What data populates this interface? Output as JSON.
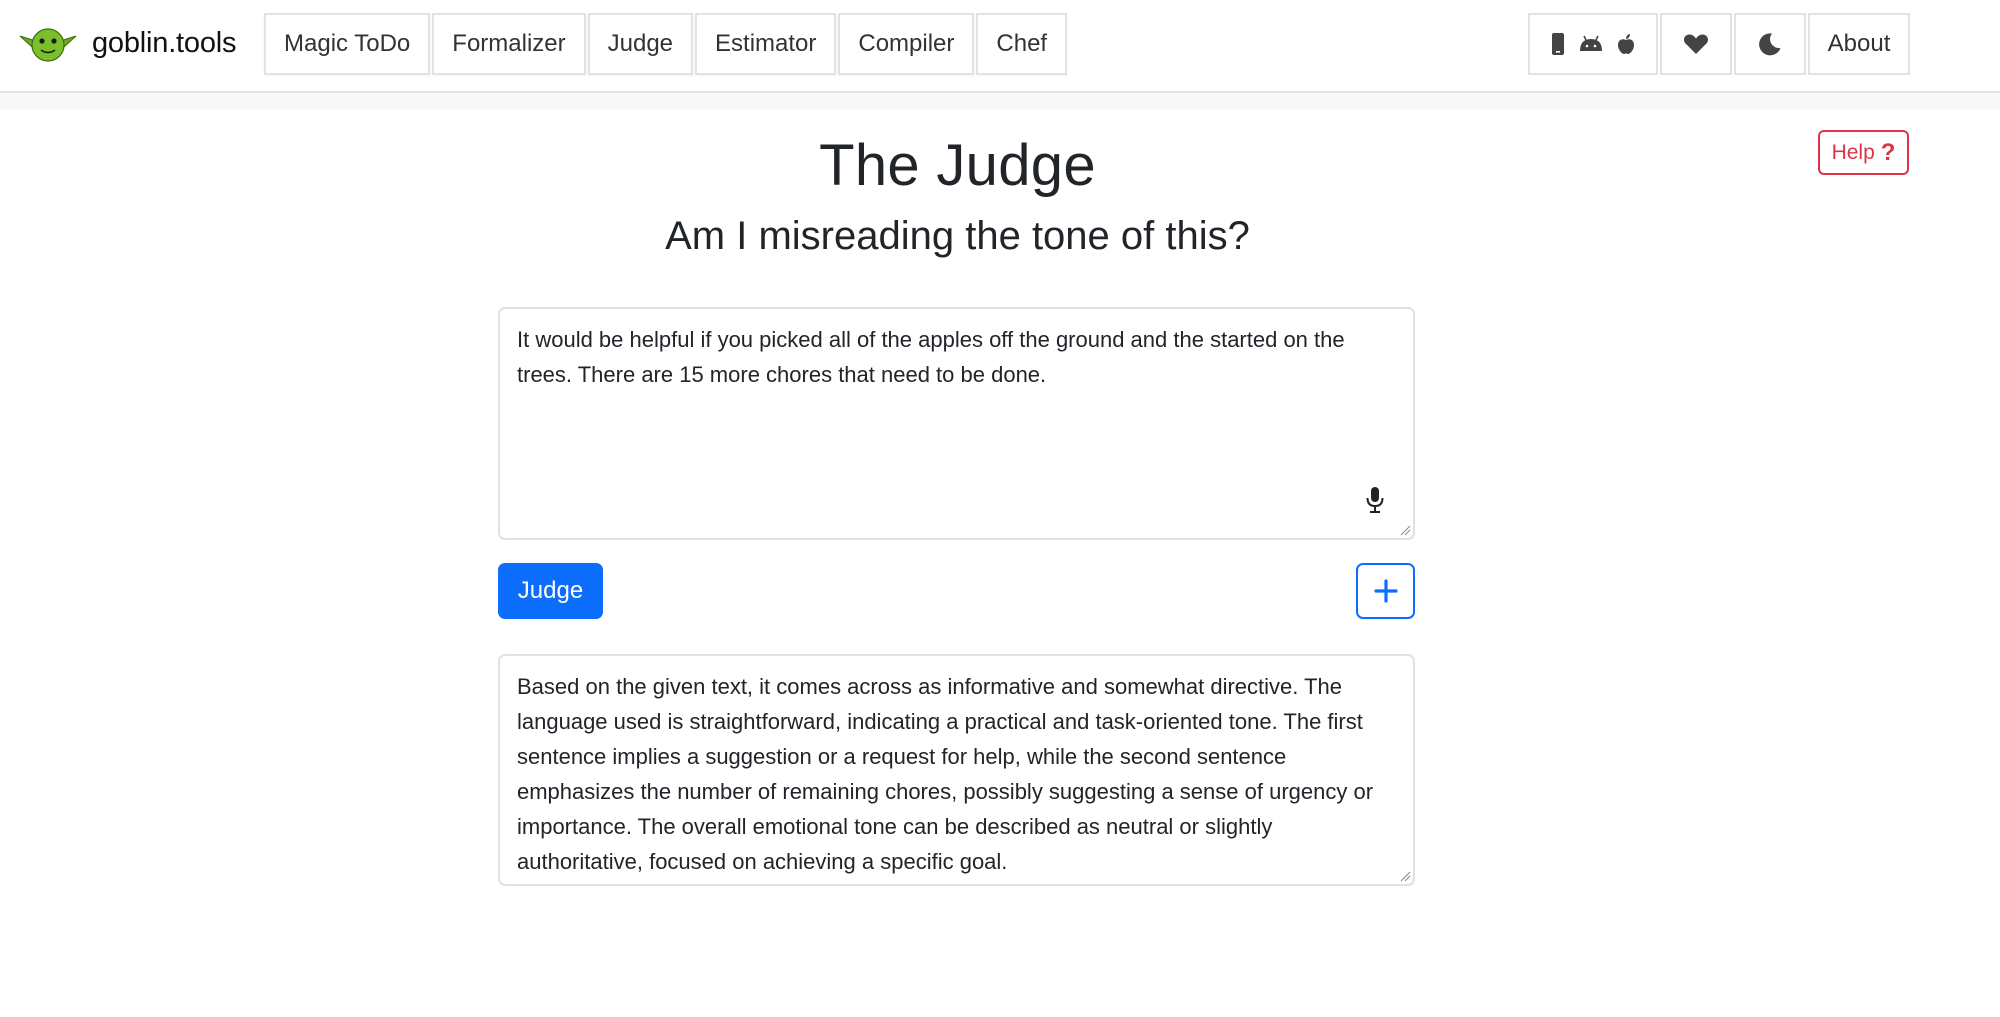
{
  "brand": {
    "name": "goblin.tools",
    "logo_icon": "goblin-face-icon"
  },
  "nav": {
    "items": [
      {
        "label": "Magic ToDo"
      },
      {
        "label": "Formalizer"
      },
      {
        "label": "Judge"
      },
      {
        "label": "Estimator"
      },
      {
        "label": "Compiler"
      },
      {
        "label": "Chef"
      }
    ],
    "right": {
      "platform_icons": [
        "phone-icon",
        "android-icon",
        "apple-icon"
      ],
      "donate_icon": "heart-icon",
      "theme_icon": "moon-icon",
      "about_label": "About"
    }
  },
  "help": {
    "label": "Help",
    "icon": "question-mark-icon",
    "color": "#dc3545"
  },
  "page": {
    "title": "The Judge",
    "subtitle": "Am I misreading the tone of this?"
  },
  "input": {
    "value": "It would be helpful if you picked all of the apples off the ground and the started on the trees. There are 15 more chores that need to be done.",
    "mic_icon": "microphone-icon"
  },
  "actions": {
    "judge_label": "Judge",
    "add_icon": "plus-icon",
    "accent": "#0d6efd"
  },
  "output": {
    "value": "Based on the given text, it comes across as informative and somewhat directive. The language used is straightforward, indicating a practical and task-oriented tone. The first sentence implies a suggestion or a request for help, while the second sentence emphasizes the number of remaining chores, possibly suggesting a sense of urgency or importance. The overall emotional tone can be described as neutral or slightly authoritative, focused on achieving a specific goal."
  }
}
